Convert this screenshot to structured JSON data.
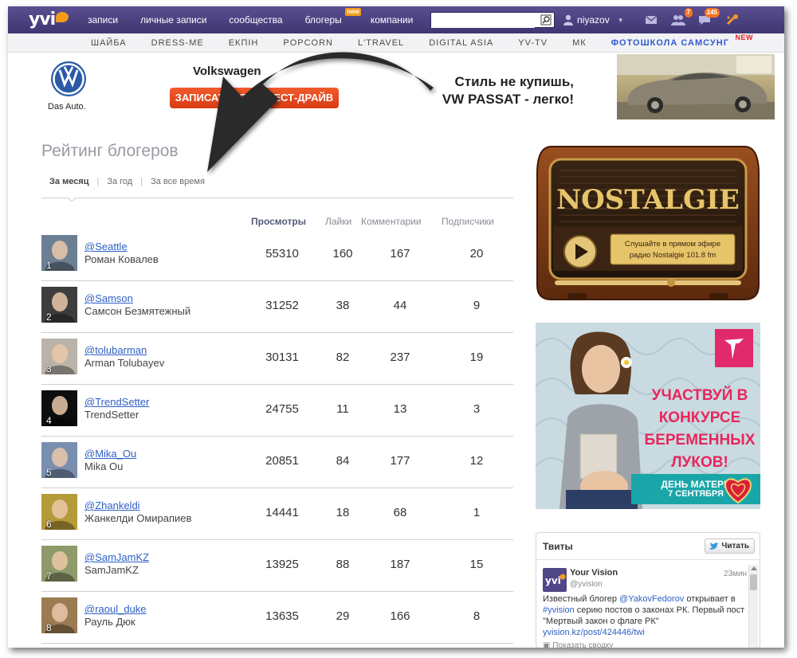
{
  "topbar": {
    "logo_text": "yvi",
    "nav": [
      {
        "label": "записи"
      },
      {
        "label": "личные записи"
      },
      {
        "label": "сообщества"
      },
      {
        "label": "блогеры",
        "tag": "new"
      },
      {
        "label": "компании"
      }
    ],
    "search_value": "",
    "username": "niyazov",
    "badges": {
      "friends": "7",
      "messages": "245"
    }
  },
  "subnav": [
    {
      "label": "ШАЙБА"
    },
    {
      "label": "DRESS-ME"
    },
    {
      "label": "ЕКПІН"
    },
    {
      "label": "POPCORN"
    },
    {
      "label": "L'TRAVEL"
    },
    {
      "label": "DIGITAL ASIA"
    },
    {
      "label": "YV-TV"
    },
    {
      "label": "МК"
    },
    {
      "label": "ФОТОШКОЛА САМСУНГ",
      "tag": "NEW",
      "highlight": true
    }
  ],
  "banner": {
    "vw_caption": "Das Auto.",
    "brand": "Volkswagen",
    "button": "ЗАПИСАТЬСЯ НА ТЕСТ-ДРАЙВ",
    "slogan_line1": "Стиль не купишь,",
    "slogan_line2": "VW PASSAT - легко!"
  },
  "main": {
    "title": "Рейтинг блогеров",
    "tabs": [
      {
        "label": "За месяц",
        "active": true
      },
      {
        "label": "За год"
      },
      {
        "label": "За все время"
      }
    ],
    "columns": {
      "views": "Просмотры",
      "likes": "Лайки",
      "comments": "Комментарии",
      "subs": "Подписчики"
    },
    "bloggers": [
      {
        "rank": "1",
        "handle": "@Seattle",
        "name": "Роман Ковалев",
        "views": "55310",
        "likes": "160",
        "comments": "167",
        "subs": "20",
        "color": "#6b7f92"
      },
      {
        "rank": "2",
        "handle": "@Samson",
        "name": "Самсон Безмятежный",
        "views": "31252",
        "likes": "38",
        "comments": "44",
        "subs": "9",
        "color": "#3d3d3d"
      },
      {
        "rank": "3",
        "handle": "@tolubarman",
        "name": "Arman Tolubayev",
        "views": "30131",
        "likes": "82",
        "comments": "237",
        "subs": "19",
        "color": "#b9b3aa"
      },
      {
        "rank": "4",
        "handle": "@TrendSetter",
        "name": "TrendSetter",
        "views": "24755",
        "likes": "11",
        "comments": "13",
        "subs": "3",
        "color": "#0d0d0d"
      },
      {
        "rank": "5",
        "handle": "@Mika_Ou",
        "name": "Mika Ou",
        "views": "20851",
        "likes": "84",
        "comments": "177",
        "subs": "12",
        "color": "#7a8fb0"
      },
      {
        "rank": "6",
        "handle": "@Zhankeldi",
        "name": "Жанкелди Омирапиев",
        "views": "14441",
        "likes": "18",
        "comments": "68",
        "subs": "1",
        "color": "#b59a3a"
      },
      {
        "rank": "7",
        "handle": "@SamJamKZ",
        "name": "SamJamKZ",
        "views": "13925",
        "likes": "88",
        "comments": "187",
        "subs": "15",
        "color": "#8e9a6a"
      },
      {
        "rank": "8",
        "handle": "@raoul_duke",
        "name": "Рауль Дюк",
        "views": "13635",
        "likes": "29",
        "comments": "166",
        "subs": "8",
        "color": "#9a7b52"
      }
    ]
  },
  "sidebar": {
    "radio": {
      "title": "NOSTALGIE",
      "line1": "Слушайте в прямом эфире",
      "line2": "радио Nostalgie 101.8 fm"
    },
    "promo": {
      "line1": "УЧАСТВУЙ В",
      "line2": "КОНКУРСЕ",
      "line3": "БЕРЕМЕННЫХ",
      "line4": "ЛУКОВ!",
      "strip1": "ДЕНЬ МАТЕРИ",
      "strip2": "7 СЕНТЯБРЯ"
    },
    "tweets": {
      "title": "Твиты",
      "follow": "Читать",
      "author": "Your Vision",
      "screen": "@yvision",
      "time": "23мин",
      "text1": "Известный блогер ",
      "mention": "@YakovFedorov",
      "text2": " открывает в ",
      "hashtag": "#yvision",
      "text3": " серию постов о законах РК. Первый пост \"Мертвый закон о флаге РК\" ",
      "link": "yvision.kz/post/424446/twi",
      "footer": "Показать сводку"
    }
  }
}
